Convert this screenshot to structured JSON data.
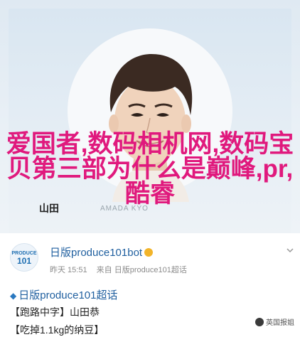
{
  "hero": {
    "caption": "爱国者,数码相机网,数码宝贝第三部为什么是巅峰,pr,酷睿",
    "watermark_name": "山田",
    "watermark_tag": "AMADA KYO"
  },
  "post": {
    "avatar_line1": "PRODUCE",
    "avatar_line2": "101",
    "username": "日版produce101bot",
    "verified_icon": "verified-badge",
    "time": "昨天 15:51",
    "source_prefix": "来自",
    "source": "日版produce101超话",
    "title": "日版produce101超话",
    "line1": "【跑路中字】山田恭",
    "line2": "【吃掉1.1kg的纳豆】",
    "badge": "英国报姐"
  },
  "colors": {
    "caption": "#e0197d",
    "link": "#1f5f9f"
  }
}
